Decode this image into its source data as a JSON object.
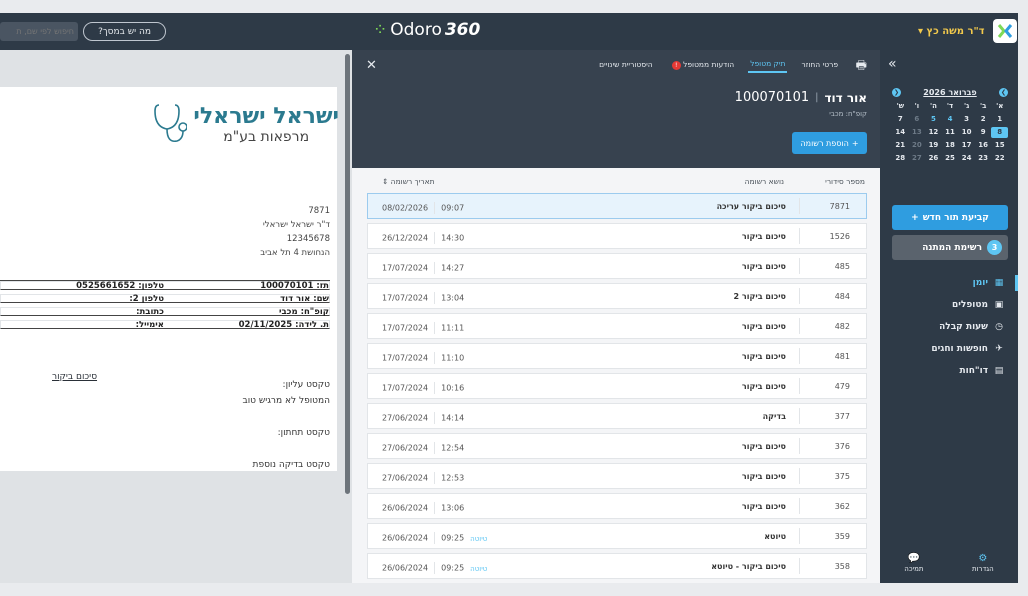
{
  "topbar": {
    "user_name": "ד\"ר משה כץ",
    "dropdown_caret": "▾",
    "app_logo_1": "Odoro",
    "app_logo_2": "360",
    "help_button": "מה יש במסך?",
    "search_placeholder": "חיפוש לפי שם, ת"
  },
  "document": {
    "org_name": "ישראל ישראלי",
    "org_sub": "מרפאות בע\"מ",
    "doc_number": "7871",
    "doctor": "ד\"ר ישראל ישראלי",
    "license": "12345678",
    "address": "הנחושת 4 תל אביב",
    "fields": [
      {
        "right": "תז: 100070101",
        "left": "טלפון: 0525661652"
      },
      {
        "right": "שם: אור דוד",
        "left": "טלפון 2:"
      },
      {
        "right": "קופ\"ח: מכבי",
        "left": "כתובת:"
      },
      {
        "right": "ת. לידה: 02/11/2025",
        "left": "אימייל:"
      }
    ],
    "section_title": "סיכום ביקור",
    "upper_label": "טקסט עליון:",
    "upper_value": "המטופל לא מרגיש טוב",
    "lower_label": "טקסט תחתון:",
    "extra_label": "טקסט בדיקה נוספת"
  },
  "main": {
    "close": "✕",
    "print_icon": "🖶",
    "tabs": [
      {
        "label": "פרטי החוזר"
      },
      {
        "label": "תיק מטופל"
      },
      {
        "label": "הודעות ממטופל"
      },
      {
        "label": "היסטוריית שינויים"
      }
    ],
    "alert_badge": "!",
    "patient_name": "אור דוד",
    "patient_sep": "|",
    "patient_id": "100070101",
    "kupah": "קופ\"ח: מכבי",
    "add_record": "הוספת רשומה",
    "add_plus": "+",
    "columns": {
      "serial": "מספר סידורי",
      "subject": "נושא רשומה",
      "date": "תאריך רשומה ⇕"
    },
    "records": [
      {
        "serial": "7871",
        "subject": "סיכום ביקור עריכה",
        "date": "08/02/2026",
        "time": "09:07",
        "tag": ""
      },
      {
        "serial": "1526",
        "subject": "סיכום ביקור",
        "date": "26/12/2024",
        "time": "14:30",
        "tag": ""
      },
      {
        "serial": "485",
        "subject": "סיכום ביקור",
        "date": "17/07/2024",
        "time": "14:27",
        "tag": ""
      },
      {
        "serial": "484",
        "subject": "סיכום ביקור 2",
        "date": "17/07/2024",
        "time": "13:04",
        "tag": ""
      },
      {
        "serial": "482",
        "subject": "סיכום ביקור",
        "date": "17/07/2024",
        "time": "11:11",
        "tag": ""
      },
      {
        "serial": "481",
        "subject": "סיכום ביקור",
        "date": "17/07/2024",
        "time": "11:10",
        "tag": ""
      },
      {
        "serial": "479",
        "subject": "סיכום ביקור",
        "date": "17/07/2024",
        "time": "10:16",
        "tag": ""
      },
      {
        "serial": "377",
        "subject": "בדיקה",
        "date": "27/06/2024",
        "time": "14:14",
        "tag": ""
      },
      {
        "serial": "376",
        "subject": "סיכום ביקור",
        "date": "27/06/2024",
        "time": "12:54",
        "tag": ""
      },
      {
        "serial": "375",
        "subject": "סיכום ביקור",
        "date": "27/06/2024",
        "time": "12:53",
        "tag": ""
      },
      {
        "serial": "362",
        "subject": "סיכום ביקור",
        "date": "26/06/2024",
        "time": "13:06",
        "tag": ""
      },
      {
        "serial": "359",
        "subject": "טיוטא",
        "date": "26/06/2024",
        "time": "09:25",
        "tag": "טיוטה"
      },
      {
        "serial": "358",
        "subject": "סיכום ביקור - טיוטא",
        "date": "26/06/2024",
        "time": "09:25",
        "tag": "טיוטה"
      }
    ]
  },
  "sidebar": {
    "collapse": "»",
    "calendar": {
      "month": "פברואר 2026",
      "prev": "❮",
      "next": "❯",
      "weekdays": [
        "א'",
        "ב'",
        "ג'",
        "ד'",
        "ה'",
        "ו'",
        "ש'"
      ],
      "weeks": [
        [
          "1",
          "2",
          "3",
          "4",
          "5",
          "6",
          "7"
        ],
        [
          "8",
          "9",
          "10",
          "11",
          "12",
          "13",
          "14"
        ],
        [
          "15",
          "16",
          "17",
          "18",
          "19",
          "20",
          "21"
        ],
        [
          "22",
          "23",
          "24",
          "25",
          "26",
          "27",
          "28"
        ]
      ]
    },
    "new_appointment": "קביעת תור חדש",
    "new_plus": "+",
    "waitlist": "רשימת המתנה",
    "waitlist_count": "3",
    "menu": [
      {
        "label": "יומן",
        "icon": "▦"
      },
      {
        "label": "מטופלים",
        "icon": "▣"
      },
      {
        "label": "שעות קבלה",
        "icon": "◷"
      },
      {
        "label": "חופשות וחגים",
        "icon": "✈"
      },
      {
        "label": "דו\"חות",
        "icon": "▤"
      }
    ],
    "support": "תמיכה",
    "settings": "הגדרות",
    "support_icon": "💬",
    "settings_icon": "⚙"
  }
}
